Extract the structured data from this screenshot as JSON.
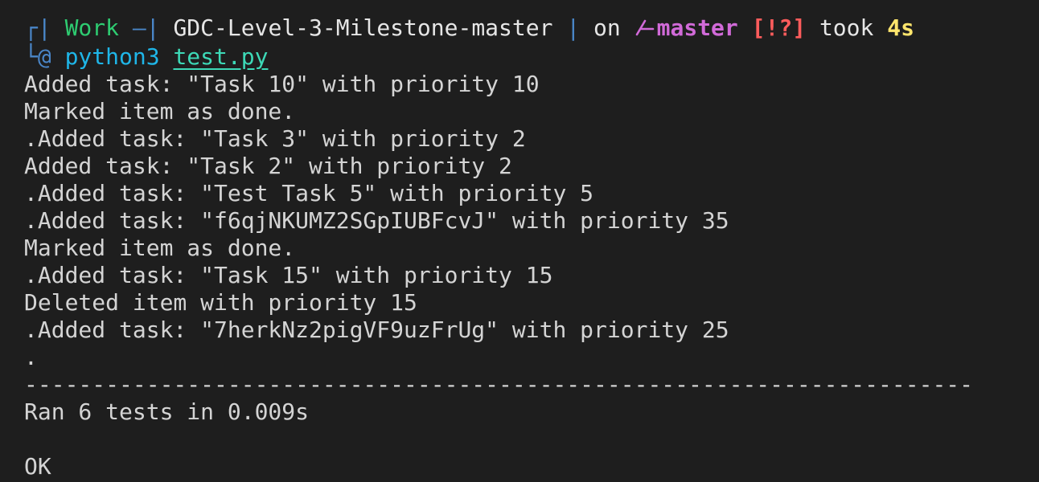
{
  "prompt": {
    "frame_top": "┌|",
    "frame_bottom": "└@",
    "workspace": "Work",
    "dir_sep_left": "—|",
    "directory": "GDC-Level-3-Milestone-master",
    "dir_sep_right": "|",
    "on_label": "on",
    "branch_icon": "git-branch-icon",
    "branch": "master",
    "git_status": "[!?]",
    "took_label": "took",
    "duration": "4s",
    "command": "python3",
    "argument": "test.py"
  },
  "output_lines": [
    "Added task: \"Task 10\" with priority 10",
    "Marked item as done.",
    ".Added task: \"Task 3\" with priority 2",
    "Added task: \"Task 2\" with priority 2",
    ".Added task: \"Test Task 5\" with priority 5",
    ".Added task: \"f6qjNKUMZ2SGpIUBFcvJ\" with priority 35",
    "Marked item as done.",
    ".Added task: \"Task 15\" with priority 15",
    "Deleted item with priority 15",
    ".Added task: \"7herkNz2pigVF9uzFrUg\" with priority 25",
    ".",
    "----------------------------------------------------------------------",
    "Ran 6 tests in 0.009s",
    "",
    "OK"
  ],
  "colors": {
    "background": "#1e1e1e",
    "text": "#d4d4d4",
    "workspace": "#2ecc71",
    "branch": "#d16ad8",
    "status": "#ff5c5c",
    "duration": "#ffe66d",
    "command": "#1fb6e8",
    "argument": "#3dd9b7"
  }
}
